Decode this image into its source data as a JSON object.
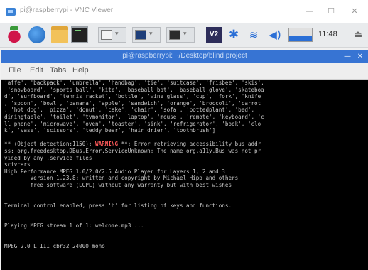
{
  "vnc_window": {
    "title": "pi@raspberrypi - VNC Viewer",
    "controls": {
      "minimize": "—",
      "maximize": "☐",
      "close": "✕"
    }
  },
  "panel": {
    "vnc_label": "V2",
    "clock": "11:48",
    "icons": {
      "menu": "raspberry-menu-icon",
      "browser": "globe-icon",
      "files": "folder-icon",
      "terminal": "terminal-icon",
      "bluetooth": "bluetooth-icon",
      "wifi": "wifi-icon",
      "volume": "volume-icon",
      "cpu": "cpu-monitor-icon",
      "eject": "eject-icon"
    },
    "glyphs": {
      "bluetooth": "✱",
      "wifi": "≋",
      "volume": "◀)",
      "eject": "⏏",
      "caret": "▾"
    }
  },
  "terminal": {
    "title": "pi@raspberrypi: ~/Desktop/blind project",
    "menu": [
      "File",
      "Edit",
      "Tabs",
      "Help"
    ],
    "controls": {
      "minimize": "—",
      "close": "✕"
    },
    "lines_before_warning": [
      "'affe', 'backpack', 'umbrella', 'handbag', 'tie', 'suitcase', 'frisbee', 'skis',",
      " 'snowboard', 'sports ball', 'kite', 'baseball bat', 'baseball glove', 'skateboa",
      "d', 'surfboard', 'tennis racket', 'bottle', 'wine glass', 'cup', 'fork', 'knife",
      ", 'spoon', 'bowl', 'banana', 'apple', 'sandwich', 'orange', 'broccoli', 'carrot",
      ", 'hot dog', 'pizza', 'donut', 'cake', 'chair', 'sofa', 'pottedplant', 'bed',",
      "diningtable', 'toilet', 'tvmonitor', 'laptop', 'mouse', 'remote', 'keyboard', 'c",
      "ll phone', 'microwave', 'oven', 'toaster', 'sink', 'refrigerator', 'book', 'clo",
      "k', 'vase', 'scissors', 'teddy bear', 'hair drier', 'toothbrush']",
      ""
    ],
    "warning_line": {
      "prefix": "** (Object detection:1150): ",
      "label": "WARNING",
      "suffix": " **: Error retrieving accessibility bus addr"
    },
    "lines_after_warning": [
      "ss: org.freedesktop.DBus.Error.ServiceUnknown: The name org.a11y.Bus was not pr",
      "vided by any .service files",
      "scivcars",
      "High Performance MPEG 1.0/2.0/2.5 Audio Player for Layers 1, 2 and 3",
      "        Version 1.23.8; written and copyright by Michael Hipp and others",
      "        free software (LGPL) without any warranty but with best wishes",
      "",
      "",
      "Terminal control enabled, press 'h' for listing of keys and functions.",
      "",
      "",
      "Playing MPEG stream 1 of 1: welcome.mp3 ...",
      "",
      "",
      "MPEG 2.0 L III cbr32 24000 mono"
    ]
  }
}
